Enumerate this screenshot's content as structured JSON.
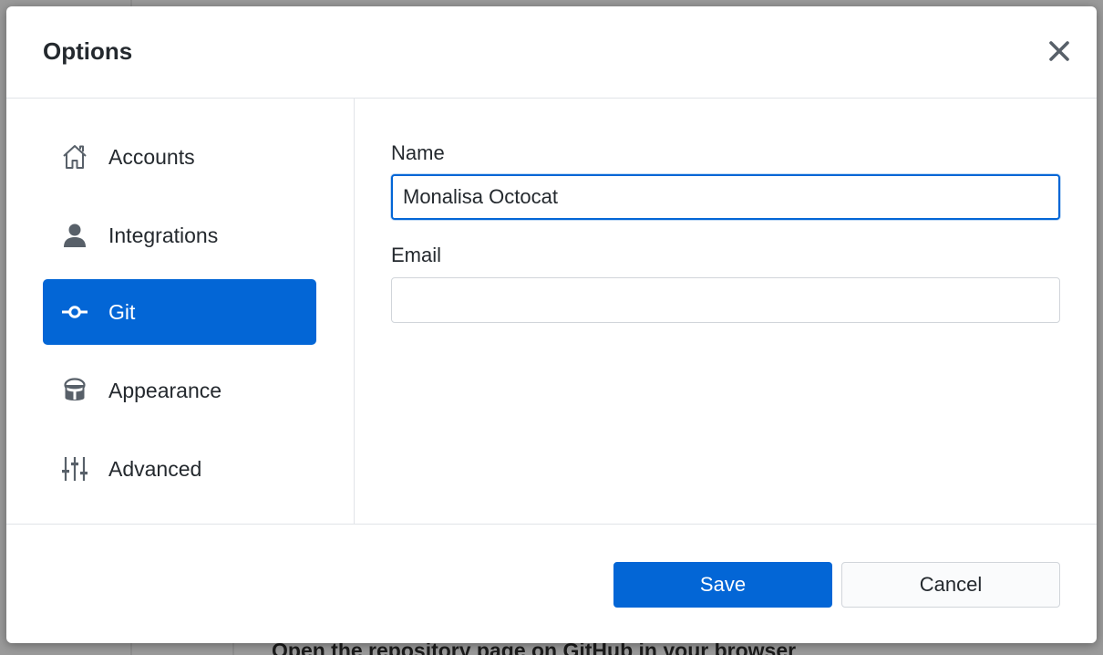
{
  "background": {
    "hint_text": "Open the repository page on GitHub in your browser"
  },
  "dialog": {
    "title": "Options",
    "close_icon": "close-icon"
  },
  "sidebar": {
    "items": [
      {
        "label": "Accounts",
        "icon": "home-icon",
        "active": false
      },
      {
        "label": "Integrations",
        "icon": "person-icon",
        "active": false
      },
      {
        "label": "Git",
        "icon": "git-commit-icon",
        "active": true
      },
      {
        "label": "Appearance",
        "icon": "paintcan-icon",
        "active": false
      },
      {
        "label": "Advanced",
        "icon": "settings-sliders-icon",
        "active": false
      }
    ]
  },
  "git": {
    "name_label": "Name",
    "name_value": "Monalisa Octocat",
    "email_label": "Email",
    "email_value": ""
  },
  "footer": {
    "save_label": "Save",
    "cancel_label": "Cancel"
  },
  "colors": {
    "accent": "#0366d6",
    "text": "#24292e",
    "border": "#e1e4e8"
  }
}
